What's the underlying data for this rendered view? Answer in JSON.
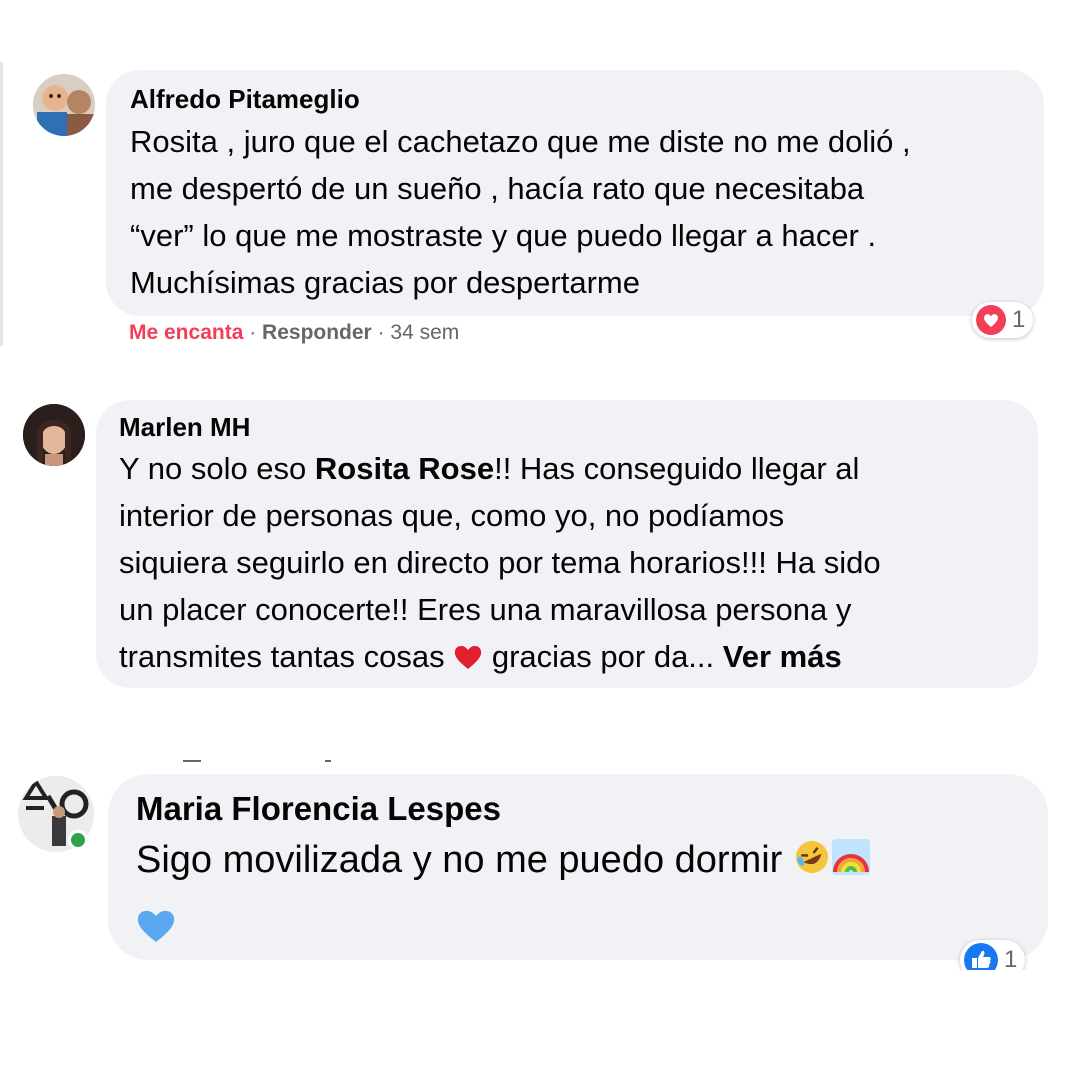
{
  "comments": [
    {
      "author": "Alfredo Pitameglio",
      "lines": [
        "Rosita , juro que el cachetazo que me diste no me dolió ,",
        "me despertó de un sueño , hacía rato que necesitaba",
        "“ver” lo que me mostraste y que puedo llegar a hacer .",
        "Muchísimas gracias por despertarme"
      ],
      "actions": {
        "love_label": "Me encanta",
        "separator": " · ",
        "reply_label": "Responder",
        "time": "34 sem"
      },
      "reaction": {
        "icon": "heart-reaction-icon",
        "count": "1",
        "color": "#f33e58"
      }
    },
    {
      "author": "Marlen MH",
      "line1_pre": "Y no solo eso ",
      "mention": "Rosita Rose",
      "line1_post": "!! Has conseguido llegar al",
      "lines": [
        "interior de personas que, como yo, no podíamos",
        "siquiera seguirlo en directo por tema horarios!!! Ha sido",
        "un placer conocerte!! Eres una maravillosa persona y"
      ],
      "last_pre": "transmites tantas cosas ",
      "last_post": " gracias por da... ",
      "see_more": "Ver más",
      "emoji": "red-heart-icon"
    },
    {
      "author": "Maria Florencia Lespes",
      "text": "Sigo movilizada y no me puedo dormir ",
      "emojis": [
        "rofl-emoji-icon",
        "rainbow-icon",
        "blue-heart-icon"
      ],
      "reaction": {
        "icon": "like-reaction-icon",
        "count": "1",
        "color": "#1877f2"
      },
      "online": true
    }
  ],
  "colors": {
    "bubble": "#f0f2f5",
    "love_action": "#f33e58",
    "meta": "#65676b",
    "online": "#31a24c"
  }
}
